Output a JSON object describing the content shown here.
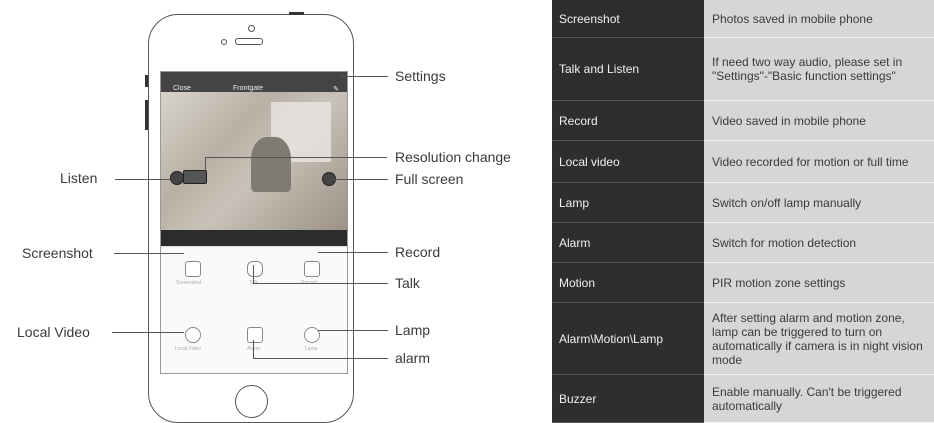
{
  "callouts": {
    "settings": "Settings",
    "resolution_change": "Resolution change",
    "full_screen": "Full screen",
    "listen": "Listen",
    "screenshot": "Screenshot",
    "record": "Record",
    "talk": "Talk",
    "local_video": "Local Video",
    "lamp": "Lamp",
    "alarm": "alarm"
  },
  "app": {
    "back_label": "Close",
    "title": "Frontgate",
    "buttons": [
      "Screenshot",
      "Talk",
      "Record",
      "Local Video",
      "Alarm",
      "Lamp"
    ]
  },
  "table": [
    {
      "feature": "Screenshot",
      "description": "Photos saved in mobile phone"
    },
    {
      "feature": "Talk and Listen",
      "description": "If need two way audio, please set in \"Settings\"-\"Basic function settings\""
    },
    {
      "feature": "Record",
      "description": "Video saved in mobile phone"
    },
    {
      "feature": "Local video",
      "description": "Video recorded for motion or full time"
    },
    {
      "feature": "Lamp",
      "description": "Switch on/off lamp manually"
    },
    {
      "feature": "Alarm",
      "description": "Switch for motion detection"
    },
    {
      "feature": "Motion",
      "description": "PIR motion zone settings"
    },
    {
      "feature": "Alarm\\Motion\\Lamp",
      "description": "After setting alarm and motion zone, lamp can be triggered to turn on automatically if camera is in night vision mode"
    },
    {
      "feature": "Buzzer",
      "description": "Enable manually. Can't be triggered automatically"
    }
  ],
  "colors": {
    "table_left_bg": "#2e2e2e",
    "table_right_bg": "#d6d6d6"
  }
}
